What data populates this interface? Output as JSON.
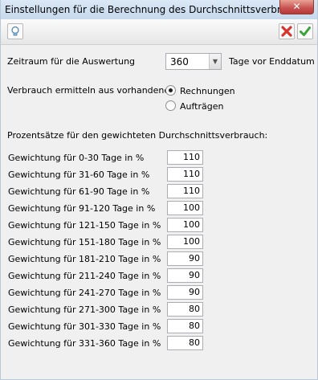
{
  "window": {
    "title": "Einstellungen für die Berechnung des Durchschnittsverbrauchs",
    "close_label": "✕"
  },
  "toolbar": {
    "left_icon": "lightbulb-icon",
    "cancel_icon": "red-x-icon",
    "ok_icon": "green-check-icon"
  },
  "colors": {
    "cancel": "#d9342b",
    "ok": "#3aa43a",
    "titlebar": "#c6d9ed"
  },
  "period": {
    "label": "Zeitraum für die Auswertung",
    "value": "360",
    "suffix": "Tage vor Enddatum"
  },
  "source": {
    "label": "Verbrauch ermitteln aus vorhandenen",
    "options": [
      {
        "label": "Rechnungen",
        "checked": true
      },
      {
        "label": "Aufträgen",
        "checked": false
      }
    ]
  },
  "weights": {
    "heading": "Prozentsätze für den gewichteten Durchschnittsverbrauch:",
    "rows": [
      {
        "label": "Gewichtung für 0-30 Tage in %",
        "value": "110"
      },
      {
        "label": "Gewichtung für 31-60 Tage in %",
        "value": "110"
      },
      {
        "label": "Gewichtung für 61-90 Tage in %",
        "value": "110"
      },
      {
        "label": "Gewichtung für 91-120 Tage in %",
        "value": "100"
      },
      {
        "label": "Gewichtung für 121-150 Tage in %",
        "value": "100"
      },
      {
        "label": "Gewichtung für 151-180 Tage in %",
        "value": "100"
      },
      {
        "label": "Gewichtung für 181-210 Tage in %",
        "value": "90"
      },
      {
        "label": "Gewichtung für 211-240 Tage in %",
        "value": "90"
      },
      {
        "label": "Gewichtung für 241-270 Tage in %",
        "value": "90"
      },
      {
        "label": "Gewichtung für 271-300 Tage in %",
        "value": "80"
      },
      {
        "label": "Gewichtung für 301-330 Tage in %",
        "value": "80"
      },
      {
        "label": "Gewichtung für 331-360 Tage in %",
        "value": "80"
      }
    ]
  }
}
